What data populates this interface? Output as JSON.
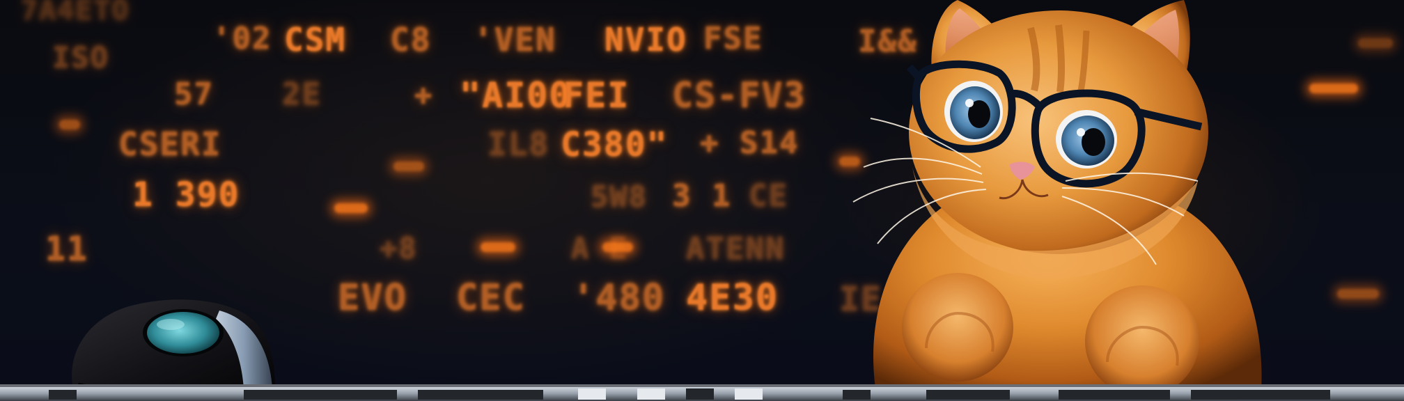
{
  "scene": {
    "subject": "orange-cat-with-glasses",
    "accent": "#e8782a",
    "background": "#05070d"
  },
  "ticker": {
    "rows": [
      [
        "7A4ETO",
        "'02",
        "CSM",
        "C8",
        "'VEN",
        "NVIO",
        "FSE",
        "I&&"
      ],
      [
        "ISO",
        "57",
        "2E",
        "+",
        "\"AI00",
        "FEI",
        "CS-FV3"
      ],
      [
        "CSERI",
        "IL8",
        "C380\"",
        "+ S14"
      ],
      [
        "1 390",
        "5W8",
        "3 1",
        "CE"
      ],
      [
        "11",
        "+8",
        "A E",
        "ATENN"
      ],
      [
        "EVO",
        "CEC",
        "'480",
        "4E30",
        "IE"
      ]
    ]
  }
}
